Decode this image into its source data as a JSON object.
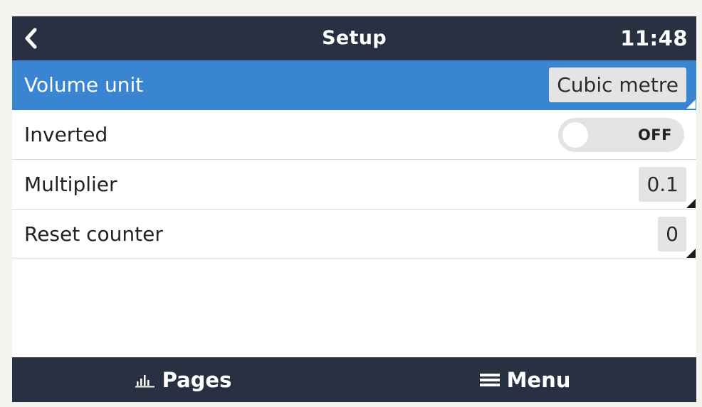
{
  "header": {
    "back_icon": "chevron-left-icon",
    "title": "Setup",
    "time": "11:48"
  },
  "rows": [
    {
      "label": "Volume unit",
      "value": "Cubic metre",
      "type": "select",
      "selected": true
    },
    {
      "label": "Inverted",
      "value": "OFF",
      "type": "toggle",
      "selected": false
    },
    {
      "label": "Multiplier",
      "value": "0.1",
      "type": "spinbox",
      "selected": false
    },
    {
      "label": "Reset counter",
      "value": "0",
      "type": "spinbox",
      "selected": false
    }
  ],
  "footer": {
    "pages_label": "Pages",
    "pages_icon": "bar-chart-icon",
    "menu_label": "Menu",
    "menu_icon": "hamburger-menu-icon"
  },
  "colors": {
    "header_bg": "#273142",
    "selected_row_bg": "#3a85d1",
    "value_box_bg": "#e4e4e4",
    "toggle_bg": "#e3e3e3"
  }
}
